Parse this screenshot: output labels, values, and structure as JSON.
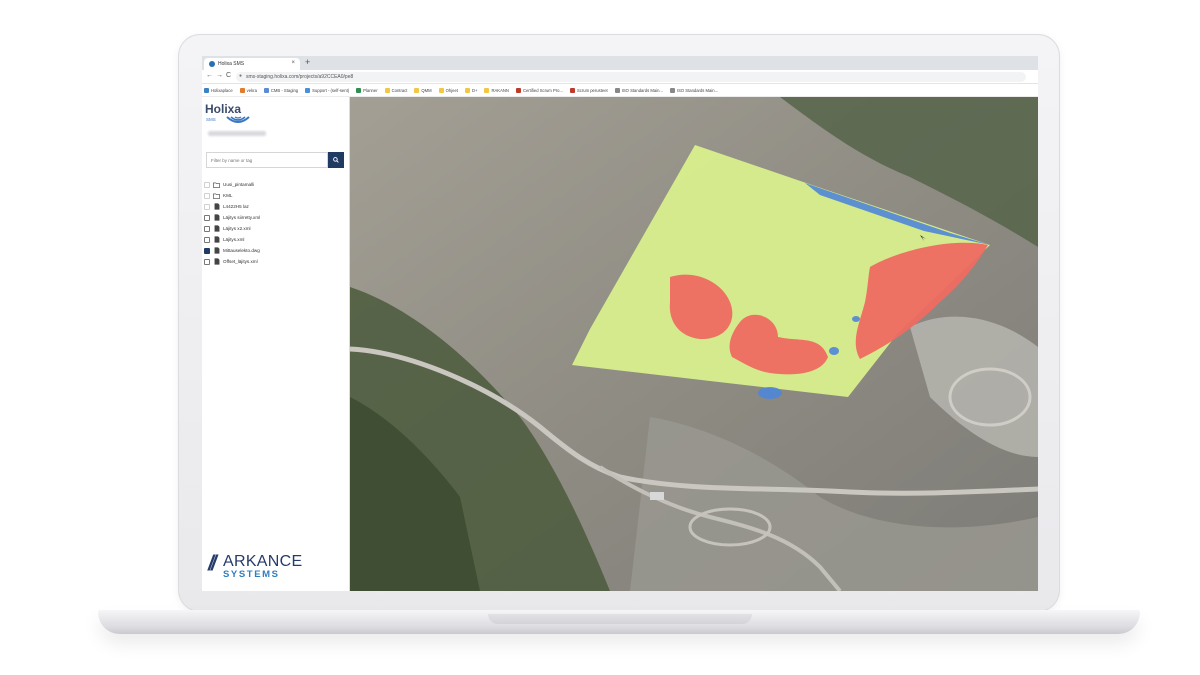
{
  "browser": {
    "tab_title": "Holixa SMS",
    "tab_close": "×",
    "new_tab": "+",
    "url": "sms-staging.holixa.com/projects/a92CCEA0/pe8",
    "nav": {
      "back": "←",
      "forward": "→",
      "reload": "C"
    },
    "bookmarks": [
      {
        "label": "Holixaplace",
        "color": "#3b82c4"
      },
      {
        "label": "vekra",
        "color": "#e27b2b"
      },
      {
        "label": "CMB - Staging",
        "color": "#5c8ad6"
      },
      {
        "label": "Support - (self-sent)",
        "color": "#4a90d9"
      },
      {
        "label": "Planner",
        "color": "#2f8f4e"
      },
      {
        "label": "Contract",
        "color": "#f2c744"
      },
      {
        "label": "QMM",
        "color": "#f2c744"
      },
      {
        "label": "Ohjeet",
        "color": "#f2c744"
      },
      {
        "label": "D+",
        "color": "#f2c744"
      },
      {
        "label": "RAKANN",
        "color": "#f2c744"
      },
      {
        "label": "Certified Scrum Pro...",
        "color": "#c0392b"
      },
      {
        "label": "Scrum perusteet",
        "color": "#c0392b"
      },
      {
        "label": "ISO Standards Main...",
        "color": "#888888"
      },
      {
        "label": "ISO Standards Main...",
        "color": "#888888"
      }
    ]
  },
  "app": {
    "logo": {
      "name": "Holixa",
      "sub": "SMS"
    },
    "search": {
      "placeholder": "Filter by name or tag"
    },
    "files": [
      {
        "label": "Uusi_pintamalli",
        "type": "folder",
        "checkbox": "dim"
      },
      {
        "label": "KML",
        "type": "folder",
        "checkbox": "dim"
      },
      {
        "label": "L4422H5 laz",
        "type": "file",
        "checkbox": "dim"
      },
      {
        "label": "Läjitys siirretty.xml",
        "type": "file",
        "checkbox": "empty"
      },
      {
        "label": "Läjitys x2.xml",
        "type": "file",
        "checkbox": "empty"
      },
      {
        "label": "Läjitys.xml",
        "type": "file",
        "checkbox": "empty"
      },
      {
        "label": "Mittauselekto.dwg",
        "type": "file",
        "checkbox": "checked"
      },
      {
        "label": "Offset_läjitys.xml",
        "type": "file",
        "checkbox": "empty"
      }
    ],
    "brand": {
      "line1": "ARKANCE",
      "line2": "SYSTEMS",
      "slashes": "//"
    }
  },
  "map": {
    "colors": {
      "fill": "#d8ef8c",
      "cut": "#ee6b61",
      "water": "#4f86d8",
      "terrain": "#8f8f88"
    }
  }
}
